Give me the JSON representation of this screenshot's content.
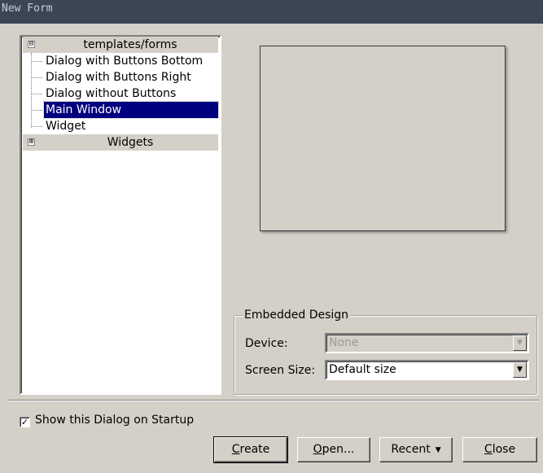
{
  "window": {
    "title": "New Form"
  },
  "tree": {
    "categories": [
      {
        "label": "templates/forms",
        "expander": "⊟",
        "expanded": true,
        "items": [
          {
            "label": "Dialog with Buttons Bottom"
          },
          {
            "label": "Dialog with Buttons Right"
          },
          {
            "label": "Dialog without Buttons"
          },
          {
            "label": "Main Window",
            "selected": true
          },
          {
            "label": "Widget"
          }
        ]
      },
      {
        "label": "Widgets",
        "expander": "⊞",
        "expanded": false
      }
    ]
  },
  "embedded": {
    "title": "Embedded Design",
    "device_label": "Device:",
    "device_value": "None",
    "screen_size_label": "Screen Size:",
    "screen_size_value": "Default size"
  },
  "startup": {
    "label": "Show this Dialog on Startup",
    "checked": true,
    "check_glyph": "✓"
  },
  "buttons": {
    "create": {
      "accel": "C",
      "rest": "reate"
    },
    "open": {
      "accel": "O",
      "rest": "pen..."
    },
    "recent": {
      "label": "Recent",
      "caret": "▼"
    },
    "close": {
      "accel": "C",
      "rest": "lose"
    }
  },
  "icons": {
    "dropdown": "▼"
  }
}
